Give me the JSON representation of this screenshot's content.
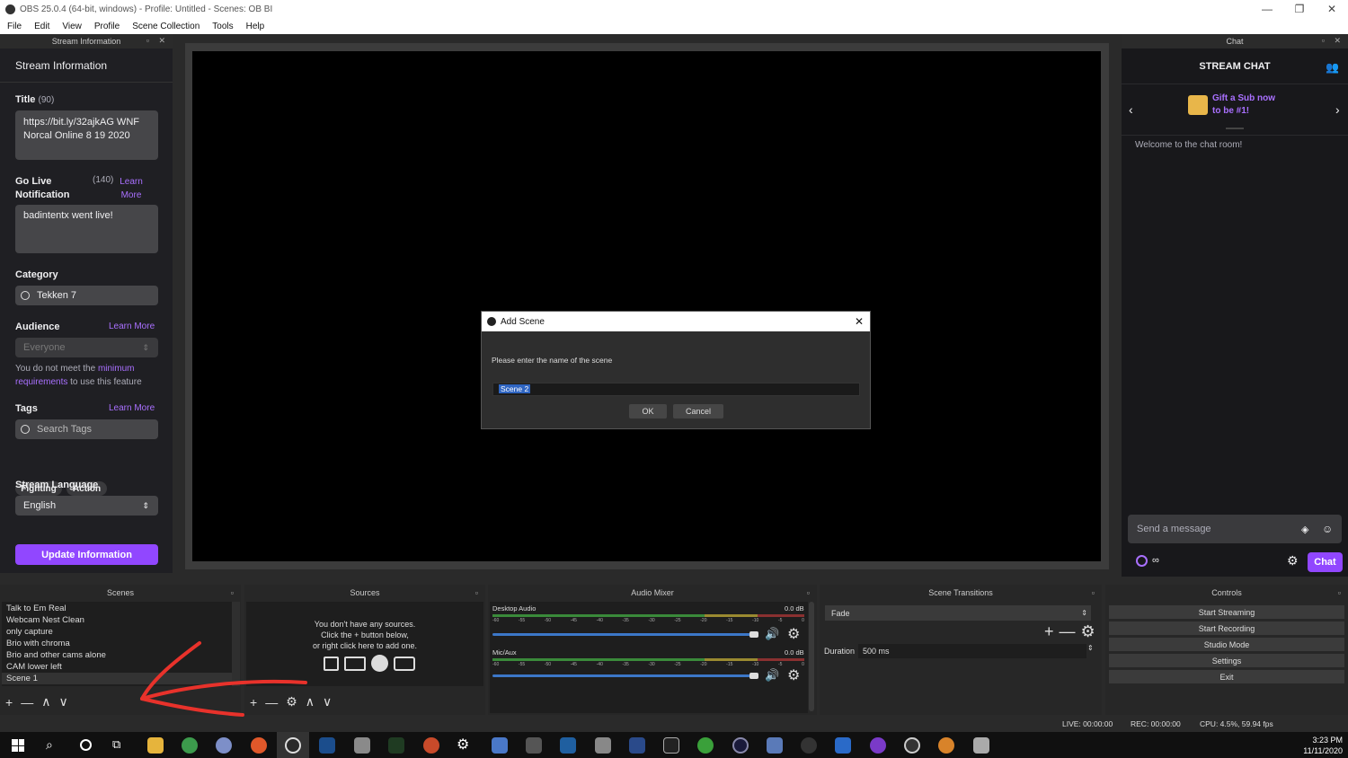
{
  "window": {
    "title": "OBS 25.0.4 (64-bit, windows) - Profile: Untitled - Scenes: OB BI"
  },
  "menu": [
    "File",
    "Edit",
    "View",
    "Profile",
    "Scene Collection",
    "Tools",
    "Help"
  ],
  "stream_info": {
    "dock_title": "Stream Information",
    "heading": "Stream Information",
    "title_label": "Title",
    "title_count": "(90)",
    "title_value": "https://bit.ly/32ajkAG WNF Norcal Online 8 19 2020",
    "golive_label": "Go Live Notification",
    "golive_count": "(140)",
    "learn_more": "Learn More",
    "golive_value": "badintentx went live!",
    "category_label": "Category",
    "category_value": "Tekken 7",
    "audience_label": "Audience",
    "audience_value": "Everyone",
    "audience_note_1": "You do not meet the ",
    "audience_note_link": "minimum requirements",
    "audience_note_2": " to use this feature",
    "tags_label": "Tags",
    "tags_placeholder": "Search Tags",
    "tags": [
      "Fighting",
      "Action"
    ],
    "language_label": "Stream Language",
    "language_value": "English",
    "update_button": "Update Information"
  },
  "chat": {
    "dock_title": "Chat",
    "heading": "STREAM CHAT",
    "gift_line1": "Gift a Sub now",
    "gift_line2": "to be #1!",
    "welcome": "Welcome to the chat room!",
    "input_placeholder": "Send a message",
    "points": "∞",
    "chat_button": "Chat"
  },
  "dialog": {
    "title": "Add Scene",
    "prompt": "Please enter the name of the scene",
    "input_value": "Scene 2",
    "ok": "OK",
    "cancel": "Cancel"
  },
  "scenes": {
    "title": "Scenes",
    "items": [
      "Talk to Em Real",
      "Webcam Nest Clean",
      "only capture",
      "Brio with chroma",
      "Brio and other cams alone",
      "CAM lower left",
      "Scene 1"
    ]
  },
  "sources": {
    "title": "Sources",
    "empty_line1": "You don't have any sources.",
    "empty_line2": "Click the + button below,",
    "empty_line3": "or right click here to add one."
  },
  "audio": {
    "title": "Audio Mixer",
    "channels": [
      {
        "name": "Desktop Audio",
        "db": "0.0 dB",
        "volume": 1.0
      },
      {
        "name": "Mic/Aux",
        "db": "0.0 dB",
        "volume": 1.0
      }
    ],
    "scale": [
      "-60",
      "-55",
      "-50",
      "-45",
      "-40",
      "-35",
      "-30",
      "-25",
      "-20",
      "-15",
      "-10",
      "-5",
      "0"
    ]
  },
  "transitions": {
    "title": "Scene Transitions",
    "selected": "Fade",
    "duration_label": "Duration",
    "duration_value": "500 ms"
  },
  "controls": {
    "title": "Controls",
    "buttons": [
      "Start Streaming",
      "Start Recording",
      "Studio Mode",
      "Settings",
      "Exit"
    ]
  },
  "status": {
    "live": "LIVE: 00:00:00",
    "rec": "REC: 00:00:00",
    "cpu": "CPU: 4.5%, 59.94 fps"
  },
  "taskbar": {
    "time": "3:23 PM",
    "date": "11/11/2020"
  },
  "colors": {
    "accent": "#9147ff",
    "annotation": "#e8322b"
  }
}
